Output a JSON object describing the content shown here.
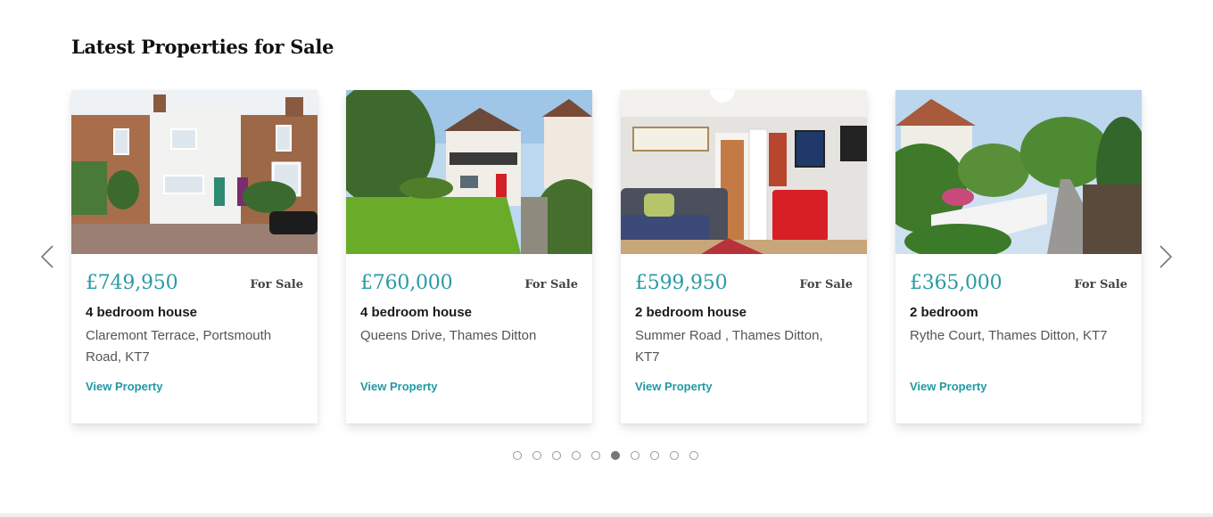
{
  "section": {
    "title": "Latest Properties for Sale"
  },
  "carousel": {
    "prev_icon": "chevron-left-icon",
    "next_icon": "chevron-right-icon",
    "active_dot": 5,
    "dot_count": 10
  },
  "colors": {
    "accent": "#2a9ba3",
    "link": "#1f9aa5"
  },
  "cards": [
    {
      "price": "£749,950",
      "status": "For Sale",
      "type": "4 bedroom house",
      "address": "Claremont Terrace, Portsmouth Road, KT7",
      "link": "View Property"
    },
    {
      "price": "£760,000",
      "status": "For Sale",
      "type": "4 bedroom house",
      "address": "Queens Drive, Thames Ditton",
      "link": "View Property"
    },
    {
      "price": "£599,950",
      "status": "For Sale",
      "type": "2 bedroom house",
      "address": "Summer Road , Thames Ditton, KT7",
      "link": "View Property"
    },
    {
      "price": "£365,000",
      "status": "For Sale",
      "type": "2 bedroom",
      "address": "Rythe Court, Thames Ditton, KT7",
      "link": "View Property"
    }
  ]
}
